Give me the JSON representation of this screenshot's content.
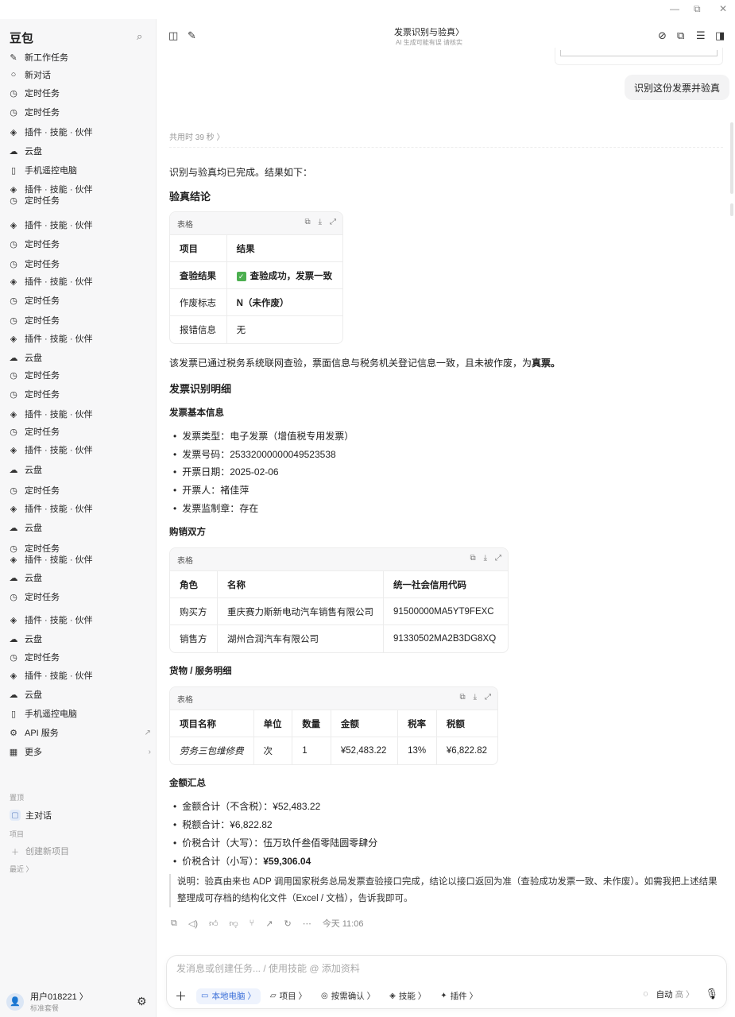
{
  "window": {
    "minimize": "—",
    "restore": "⧉",
    "close": "✕"
  },
  "sidebar": {
    "brand": "豆包",
    "items": [
      {
        "icon": "edit-icon",
        "glyph": "✎",
        "label": "新工作任务"
      },
      {
        "icon": "chat-icon",
        "glyph": "○",
        "label": "新对话"
      },
      {
        "icon": "clock-icon",
        "glyph": "◷",
        "label": "定时任务"
      },
      {
        "icon": "clock-icon",
        "glyph": "◷",
        "label": "定时任务"
      },
      {
        "icon": "layers-icon",
        "glyph": "◈",
        "label": "插件 · 技能 · 伙伴"
      },
      {
        "icon": "cloud-icon",
        "glyph": "☁",
        "label": "云盘"
      },
      {
        "icon": "phone-icon",
        "glyph": "▯",
        "label": "手机遥控电脑"
      },
      {
        "icon": "layers-icon",
        "glyph": "◈",
        "label": "插件 · 技能 · 伙伴"
      },
      {
        "icon": "clock-icon",
        "glyph": "◷",
        "label": "定时任务"
      },
      {
        "icon": "layers-icon",
        "glyph": "◈",
        "label": "插件 · 技能 · 伙伴"
      },
      {
        "icon": "clock-icon",
        "glyph": "◷",
        "label": "定时任务"
      },
      {
        "icon": "clock-icon",
        "glyph": "◷",
        "label": "定时任务"
      },
      {
        "icon": "layers-icon",
        "glyph": "◈",
        "label": "插件 · 技能 · 伙伴"
      },
      {
        "icon": "clock-icon",
        "glyph": "◷",
        "label": "定时任务"
      },
      {
        "icon": "clock-icon",
        "glyph": "◷",
        "label": "定时任务"
      },
      {
        "icon": "layers-icon",
        "glyph": "◈",
        "label": "插件 · 技能 · 伙伴"
      },
      {
        "icon": "cloud-icon",
        "glyph": "☁",
        "label": "云盘"
      },
      {
        "icon": "clock-icon",
        "glyph": "◷",
        "label": "定时任务"
      },
      {
        "icon": "clock-icon",
        "glyph": "◷",
        "label": "定时任务"
      },
      {
        "icon": "layers-icon",
        "glyph": "◈",
        "label": "插件 · 技能 · 伙伴"
      },
      {
        "icon": "clock-icon",
        "glyph": "◷",
        "label": "定时任务"
      },
      {
        "icon": "layers-icon",
        "glyph": "◈",
        "label": "插件 · 技能 · 伙伴"
      },
      {
        "icon": "cloud-icon",
        "glyph": "☁",
        "label": "云盘"
      },
      {
        "icon": "clock-icon",
        "glyph": "◷",
        "label": "定时任务"
      },
      {
        "icon": "layers-icon",
        "glyph": "◈",
        "label": "插件 · 技能 · 伙伴"
      },
      {
        "icon": "cloud-icon",
        "glyph": "☁",
        "label": "云盘"
      },
      {
        "icon": "clock-icon",
        "glyph": "◷",
        "label": "定时任务"
      },
      {
        "icon": "layers-icon",
        "glyph": "◈",
        "label": "插件 · 技能 · 伙伴"
      },
      {
        "icon": "cloud-icon",
        "glyph": "☁",
        "label": "云盘"
      },
      {
        "icon": "clock-icon",
        "glyph": "◷",
        "label": "定时任务"
      },
      {
        "icon": "layers-icon",
        "glyph": "◈",
        "label": "插件 · 技能 · 伙伴"
      },
      {
        "icon": "cloud-icon",
        "glyph": "☁",
        "label": "云盘"
      },
      {
        "icon": "clock-icon",
        "glyph": "◷",
        "label": "定时任务"
      },
      {
        "icon": "layers-icon",
        "glyph": "◈",
        "label": "插件 · 技能 · 伙伴"
      },
      {
        "icon": "cloud-icon",
        "glyph": "☁",
        "label": "云盘"
      },
      {
        "icon": "phone-icon",
        "glyph": "▯",
        "label": "手机遥控电脑"
      },
      {
        "icon": "api-icon",
        "glyph": "⚙",
        "label": "API 服务",
        "tail": "↗"
      },
      {
        "icon": "grid-icon",
        "glyph": "▦",
        "label": "更多",
        "tail": "›"
      }
    ],
    "pinned_label": "置顶",
    "pinned_item": "主对话",
    "projects_label": "项目",
    "new_project": "创建新项目",
    "recent_label": "最近 〉",
    "user_name": "用户018221 〉",
    "user_plan": "标准套餐"
  },
  "topbar": {
    "title": "发票识别与验真〉",
    "subtitle": "AI 生成可能有误 请核实"
  },
  "conversation": {
    "user_message": "识别这份发票并验真",
    "elapsed": "共用时 39 秒 〉",
    "intro": "识别与验真均已完成。结果如下：",
    "verify_heading": "验真结论",
    "table_label": "表格",
    "verify_table": {
      "headers": [
        "项目",
        "结果"
      ],
      "rows": [
        [
          "查验结果",
          "查验成功，发票一致"
        ],
        [
          "作废标志",
          "N（未作废）"
        ],
        [
          "报错信息",
          "无"
        ]
      ]
    },
    "verdict_prefix": "该发票已通过税务系统联网查验，票面信息与税务机关登记信息一致，且未被作废，为",
    "verdict_strong": "真票。",
    "detail_heading": "发票识别明细",
    "basic_heading": "发票基本信息",
    "basic_items": [
      "发票类型：电子发票（增值税专用发票）",
      "发票号码：25332000000049523538",
      "开票日期：2025-02-06",
      "开票人：褚佳萍",
      "发票监制章：存在"
    ],
    "parties_heading": "购销双方",
    "parties_table": {
      "headers": [
        "角色",
        "名称",
        "统一社会信用代码"
      ],
      "rows": [
        [
          "购买方",
          "重庆赛力斯新电动汽车销售有限公司",
          "91500000MA5YT9FEXC"
        ],
        [
          "销售方",
          "湖州合润汽车有限公司",
          "91330502MA2B3DG8XQ"
        ]
      ]
    },
    "goods_heading": "货物 / 服务明细",
    "goods_table": {
      "headers": [
        "项目名称",
        "单位",
        "数量",
        "金额",
        "税率",
        "税额"
      ],
      "rows": [
        [
          "劳务三包维修费",
          "次",
          "1",
          "¥52,483.22",
          "13%",
          "¥6,822.82"
        ]
      ]
    },
    "amount_heading": "金额汇总",
    "amount_items": [
      "金额合计（不含税）：¥52,483.22",
      "税额合计：¥6,822.82",
      "价税合计（大写）：伍万玖仟叁佰零陆圆零肆分"
    ],
    "amount_last_prefix": "价税合计（小写）：",
    "amount_last_strong": "¥59,306.04",
    "note": "说明：验真由来也 ADP 调用国家税务总局发票查验接口完成，结论以接口返回为准（查验成功发票一致、未作废）。如需我把上述结果整理成可存档的结构化文件（Excel / 文档），告诉我即可。",
    "timestamp": "今天 11:06"
  },
  "composer": {
    "placeholder": "发消息或创建任务... / 使用技能 @ 添加资料",
    "chips": [
      {
        "icon": "laptop-icon",
        "glyph": "▭",
        "label": "本地电脑 〉",
        "active": true
      },
      {
        "icon": "folder-icon",
        "glyph": "▱",
        "label": "项目 〉"
      },
      {
        "icon": "check-circle-icon",
        "glyph": "◎",
        "label": "按需确认 〉"
      },
      {
        "icon": "layers-icon",
        "glyph": "◈",
        "label": "技能 〉"
      },
      {
        "icon": "plugin-icon",
        "glyph": "✦",
        "label": "插件 〉"
      }
    ],
    "mode": "自动",
    "mode_level": "高 〉"
  }
}
